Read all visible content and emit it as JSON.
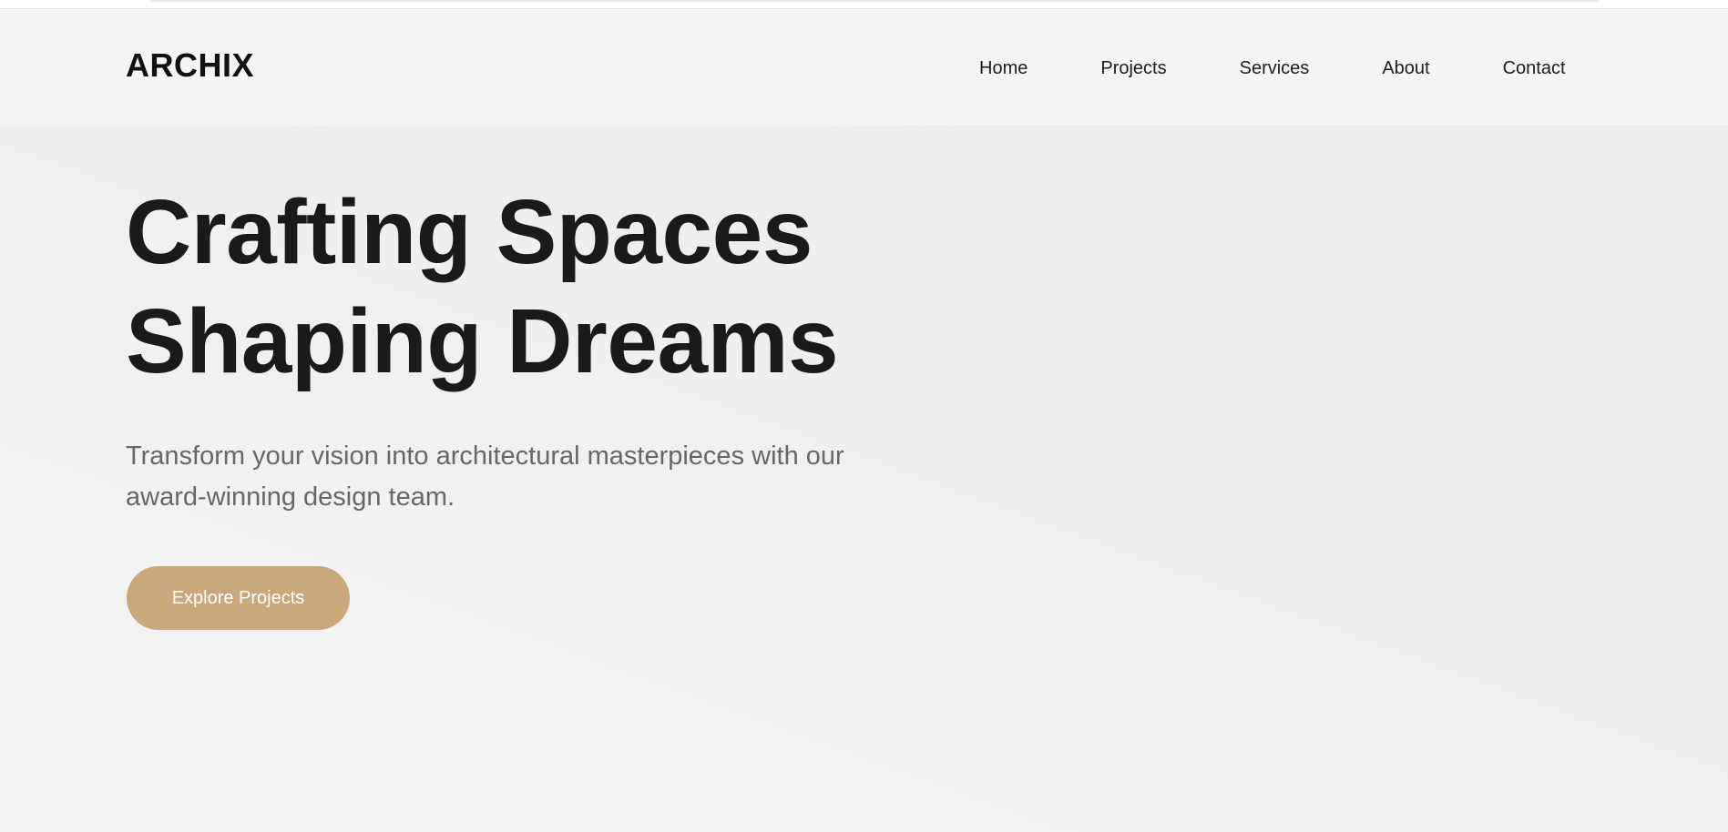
{
  "brand": {
    "logo_text": "ARCHIX"
  },
  "nav": {
    "items": [
      {
        "label": "Home"
      },
      {
        "label": "Projects"
      },
      {
        "label": "Services"
      },
      {
        "label": "About"
      },
      {
        "label": "Contact"
      }
    ]
  },
  "hero": {
    "title_line1": "Crafting Spaces",
    "title_line2": "Shaping Dreams",
    "subtitle": "Transform your vision into architectural masterpieces with our award-winning design team.",
    "cta_label": "Explore Projects"
  },
  "colors": {
    "accent": "#c9a87c",
    "heading": "#1a1a1a",
    "body_text": "#676767",
    "nav_background": "#f4f4f4"
  }
}
